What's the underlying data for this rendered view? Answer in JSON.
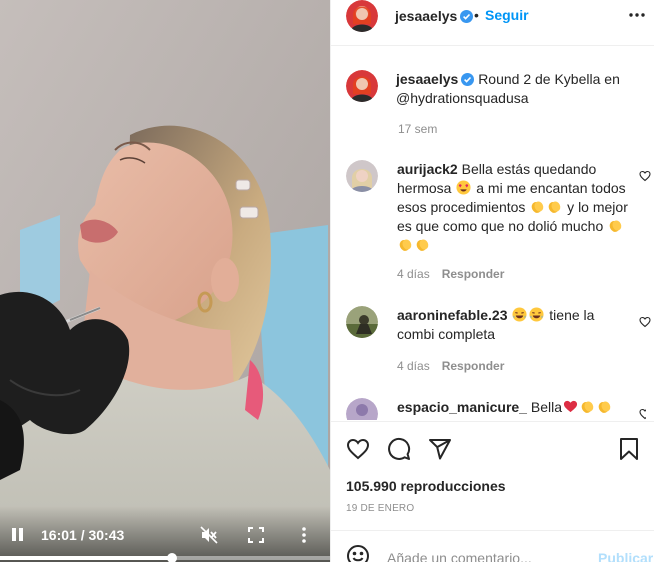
{
  "post": {
    "author": "jesaaelys",
    "follow_label": "Seguir",
    "separator": "•",
    "caption_text": "Round 2 de Kybella en @hydrationsquadusa",
    "caption_time": "17 sem"
  },
  "video": {
    "time_display": "16:01 / 30:43",
    "progress": 0.521
  },
  "comments": [
    {
      "author": "aurijack2",
      "segments": [
        "Bella estás quedando hermosa ",
        " a mi me encantan todos esos procedimientos ",
        " y lo mejor es que como que no dolió mucho "
      ],
      "emojis": [
        [
          "heart-eyes-emoji"
        ],
        [
          "clap-emoji",
          "clap-emoji"
        ],
        [
          "clap-emoji",
          "clap-emoji",
          "clap-emoji"
        ]
      ],
      "time": "4 días",
      "reply_label": "Responder"
    },
    {
      "author": "aaroninefable.23",
      "segments": [
        " ",
        " tiene la combi completa"
      ],
      "emojis": [
        [
          "laugh-emoji",
          "laugh-emoji"
        ]
      ],
      "time": "4 días",
      "reply_label": "Responder"
    },
    {
      "author": "espacio_manicure_",
      "segments": [
        "Bella"
      ],
      "emojis": [
        [
          "red-heart-emoji",
          "clap-emoji",
          "clap-emoji",
          "clap-emoji"
        ]
      ],
      "time": "",
      "reply_label": ""
    }
  ],
  "stats": {
    "views": "105.990 reproducciones",
    "date": "19 DE ENERO"
  },
  "add_comment": {
    "placeholder": "Añade un comentario...",
    "publish_label": "Publicar"
  },
  "icons": {
    "verified": "verified-badge-icon",
    "more": "more-horizontal-icon",
    "like": "heart-icon",
    "comment": "comment-icon",
    "share": "send-icon",
    "save": "bookmark-icon",
    "emoji": "emoji-icon",
    "play": "pause-icon",
    "mute": "muted-speaker-icon",
    "fullscreen": "fullscreen-icon",
    "options": "more-vertical-icon"
  },
  "colors": {
    "accent": "#0095f6",
    "publish_disabled": "#b2dffc",
    "verified": "#3897f0",
    "muted_text": "#8e8e8e"
  }
}
